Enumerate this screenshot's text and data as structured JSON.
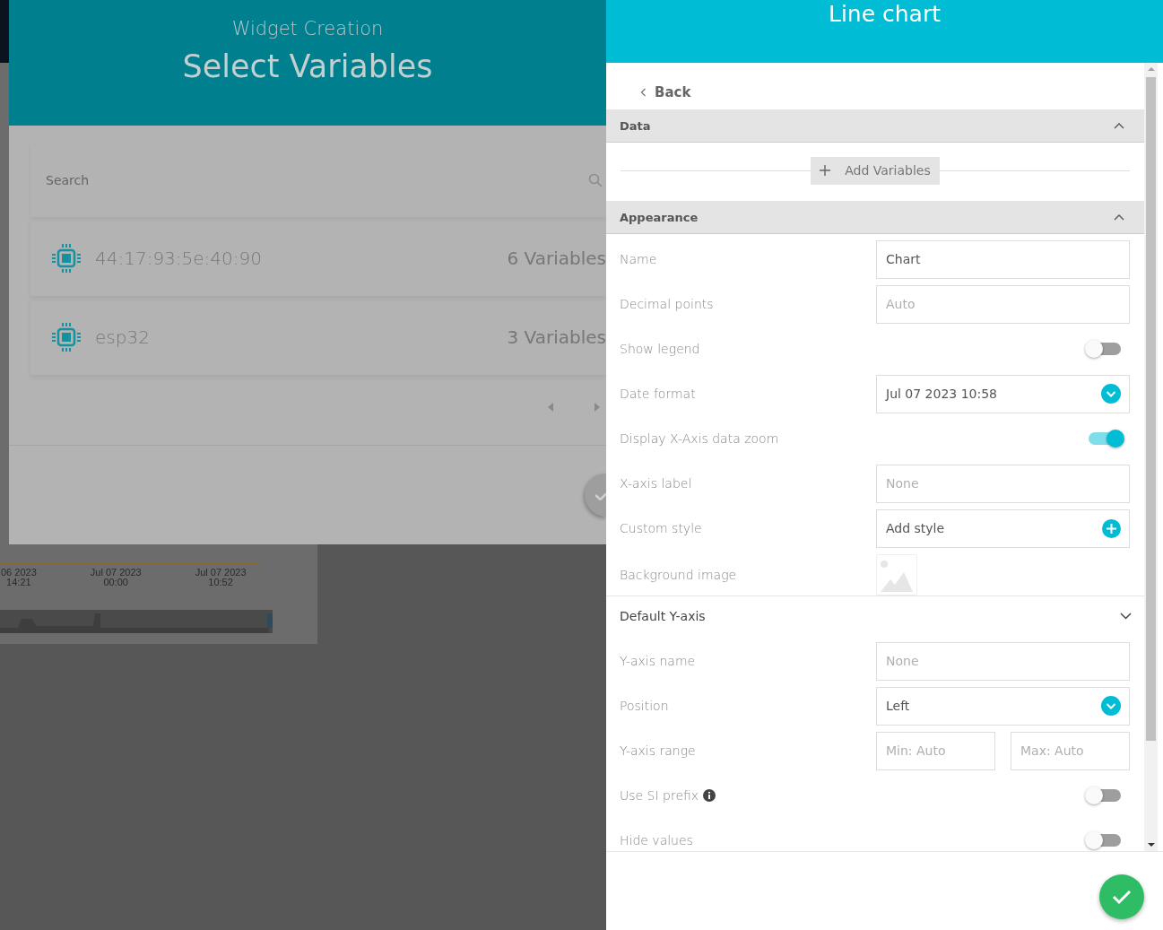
{
  "background": {
    "axis_labels": [
      {
        "line1": "06 2023",
        "line2": "14:21"
      },
      {
        "line1": "Jul 07 2023",
        "line2": "00:00"
      },
      {
        "line1": "Jul 07 2023",
        "line2": "10:52"
      }
    ]
  },
  "modal": {
    "subtitle": "Widget Creation",
    "title": "Select Variables",
    "search": {
      "placeholder": "Search"
    },
    "devices": [
      {
        "name": "44:17:93:5e:40:90",
        "count": "6 Variables"
      },
      {
        "name": "esp32",
        "count": "3 Variables"
      }
    ]
  },
  "panel": {
    "title": "Line chart",
    "back": "Back",
    "sections": [
      {
        "kind": "group",
        "title": "Data",
        "add_button": "Add Variables"
      },
      {
        "kind": "group",
        "title": "Appearance",
        "rows": [
          {
            "kind": "input",
            "label": "Name",
            "value": "Chart"
          },
          {
            "kind": "input",
            "label": "Decimal points",
            "placeholder": "Auto"
          },
          {
            "kind": "toggle",
            "label": "Show legend",
            "on": false
          },
          {
            "kind": "select",
            "label": "Date format",
            "value": "Jul 07 2023 10:58"
          },
          {
            "kind": "toggle",
            "label": "Display X-Axis data zoom",
            "on": true
          },
          {
            "kind": "input",
            "label": "X-axis label",
            "placeholder": "None"
          },
          {
            "kind": "action",
            "label": "Custom style",
            "value": "Add style"
          },
          {
            "kind": "image",
            "label": "Background image"
          }
        ]
      },
      {
        "kind": "subheader",
        "title": "Default Y-axis",
        "rows": [
          {
            "kind": "input",
            "label": "Y-axis name",
            "placeholder": "None"
          },
          {
            "kind": "select",
            "label": "Position",
            "value": "Left"
          },
          {
            "kind": "range",
            "label": "Y-axis range",
            "min_placeholder": "Min: Auto",
            "max_placeholder": "Max: Auto"
          },
          {
            "kind": "toggle",
            "label": "Use SI prefix",
            "info": true,
            "on": false
          },
          {
            "kind": "toggle",
            "label": "Hide values",
            "on": false
          }
        ]
      }
    ]
  }
}
